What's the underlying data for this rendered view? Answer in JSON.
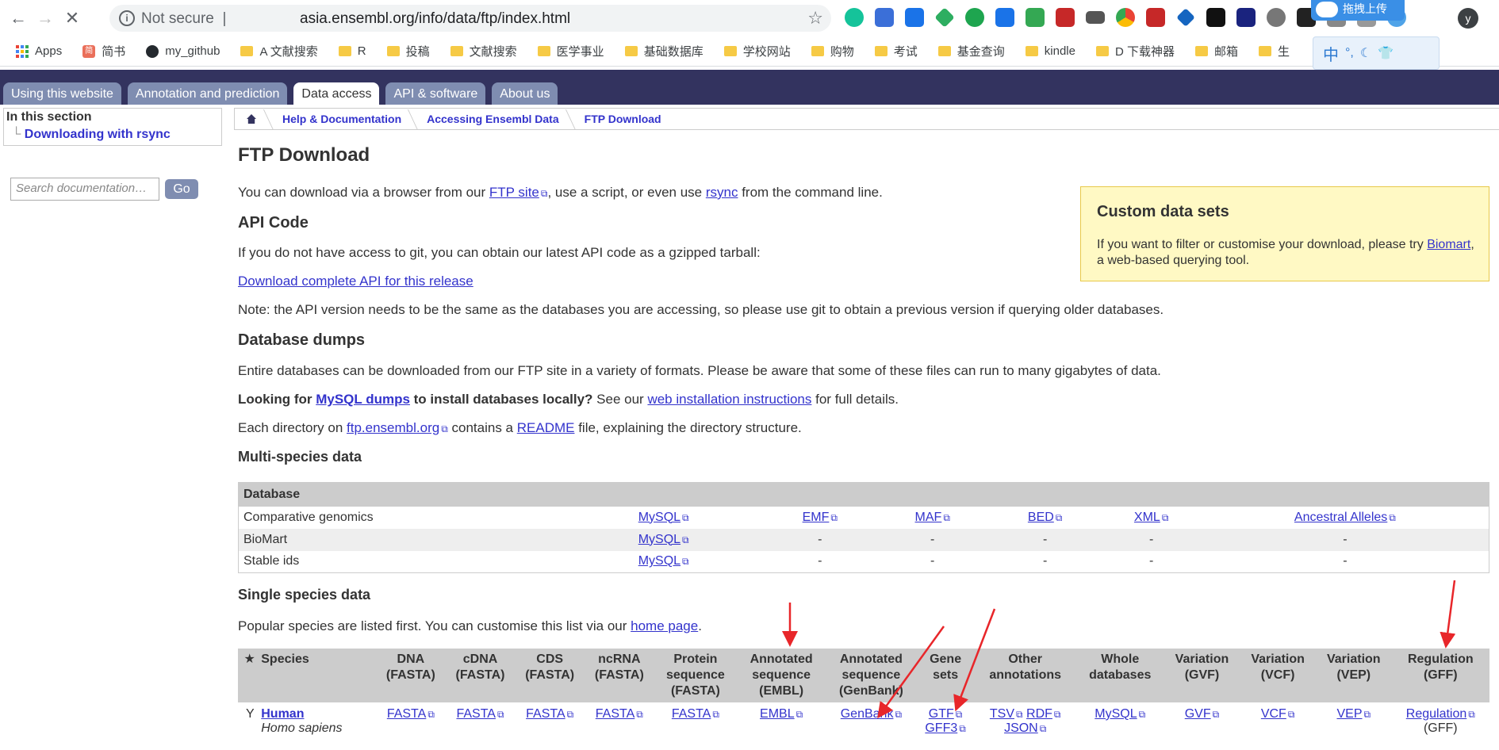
{
  "browser": {
    "security_label": "Not secure",
    "separator": "|",
    "url": "asia.ensembl.org/info/data/ftp/index.html",
    "upload_label": "拖拽上传",
    "profile_initial": "y",
    "bookmarks": [
      {
        "icon": "apps-icon",
        "label": "Apps"
      },
      {
        "icon": "jianshu-icon",
        "label": "简书"
      },
      {
        "icon": "github-icon",
        "label": "my_github"
      },
      {
        "icon": "folder-icon",
        "label": "A 文献搜索"
      },
      {
        "icon": "folder-icon",
        "label": "R"
      },
      {
        "icon": "folder-icon",
        "label": "投稿"
      },
      {
        "icon": "folder-icon",
        "label": "文献搜索"
      },
      {
        "icon": "folder-icon",
        "label": "医学事业"
      },
      {
        "icon": "folder-icon",
        "label": "基础数据库"
      },
      {
        "icon": "folder-icon",
        "label": "学校网站"
      },
      {
        "icon": "folder-icon",
        "label": "购物"
      },
      {
        "icon": "folder-icon",
        "label": "考试"
      },
      {
        "icon": "folder-icon",
        "label": "基金查询"
      },
      {
        "icon": "folder-icon",
        "label": "kindle"
      },
      {
        "icon": "folder-icon",
        "label": "D 下载神器"
      },
      {
        "icon": "folder-icon",
        "label": "邮箱"
      },
      {
        "icon": "folder-icon",
        "label": "生"
      }
    ],
    "ime_char": "中"
  },
  "tabs": [
    "Using this website",
    "Annotation and prediction",
    "Data access",
    "API & software",
    "About us"
  ],
  "sidebar": {
    "heading": "In this section",
    "item": "Downloading with rsync",
    "search_placeholder": "Search documentation…",
    "go_label": "Go"
  },
  "breadcrumb": [
    "Help & Documentation",
    "Accessing Ensembl Data",
    "FTP Download"
  ],
  "page": {
    "title": "FTP Download",
    "intro_1": "You can download via a browser from our ",
    "ftp_site": "FTP site",
    "intro_2": ", use a script, or even use ",
    "rsync": "rsync",
    "intro_3": " from the command line.",
    "api_heading": "API Code",
    "api_text": "If you do not have access to git, you can obtain our latest API code as a gzipped tarball:",
    "api_link": "Download complete API for this release",
    "api_note": "Note: the API version needs to be the same as the databases you are accessing, so please use git to obtain a previous version if querying older databases.",
    "dumps_heading": "Database dumps",
    "dumps_text": "Entire databases can be downloaded from our FTP site in a variety of formats. Please be aware that some of these files can run to many gigabytes of data.",
    "looking_1": "Looking for ",
    "mysql_dumps": "MySQL dumps",
    "looking_2": " to install databases locally?",
    "looking_3": " See our ",
    "web_install": "web installation instructions",
    "looking_4": " for full details.",
    "each_1": "Each directory on ",
    "ftp_ensembl": "ftp.ensembl.org",
    "each_2": " contains a ",
    "readme": "README",
    "each_3": " file, explaining the directory structure.",
    "multi_heading": "Multi-species data",
    "single_heading": "Single species data",
    "popular_1": "Popular species are listed first. You can customise this list via our ",
    "home_page": "home page",
    "popular_2": "."
  },
  "custom_box": {
    "title": "Custom data sets",
    "text_1": "If you want to filter or customise your download, please try ",
    "biomart": "Biomart",
    "text_2": ", a web-based querying tool."
  },
  "multi_table": {
    "header": "Database",
    "rows": [
      [
        "Comparative genomics",
        "MySQL",
        "EMF",
        "MAF",
        "BED",
        "XML",
        "Ancestral Alleles"
      ],
      [
        "BioMart",
        "MySQL",
        "-",
        "-",
        "-",
        "-",
        "-"
      ],
      [
        "Stable ids",
        "MySQL",
        "-",
        "-",
        "-",
        "-",
        "-"
      ]
    ]
  },
  "single_table": {
    "headers": [
      "★",
      "Species",
      "DNA\n(FASTA)",
      "cDNA\n(FASTA)",
      "CDS\n(FASTA)",
      "ncRNA\n(FASTA)",
      "Protein\nsequence\n(FASTA)",
      "Annotated\nsequence\n(EMBL)",
      "Annotated\nsequence\n(GenBank)",
      "Gene\nsets",
      "Other\nannotations",
      "Whole\ndatabases",
      "Variation\n(GVF)",
      "Variation\n(VCF)",
      "Variation\n(VEP)",
      "Regulation\n(GFF)"
    ],
    "human": {
      "fav": "Y",
      "name": "Human",
      "latin": "Homo sapiens",
      "dna": "FASTA",
      "cdna": "FASTA",
      "cds": "FASTA",
      "ncrna": "FASTA",
      "protein": "FASTA",
      "embl": "EMBL",
      "genbank": "GenBank",
      "gtf": "GTF",
      "gff3": "GFF3",
      "tsv": "TSV",
      "rdf": "RDF",
      "json": "JSON",
      "mysql": "MySQL",
      "gvf": "GVF",
      "vcf": "VCF",
      "vep": "VEP",
      "regulation": "Regulation",
      "gff": "(GFF)"
    }
  },
  "annotation_color": "#e8262a"
}
